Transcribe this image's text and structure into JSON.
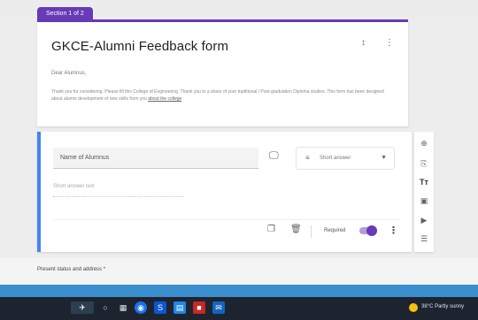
{
  "section_tab": "Section 1 of 2",
  "form": {
    "title": "GKCE-Alumni Feedback form",
    "greeting": "Dear Alumnus,",
    "description": "Thank you for considering. Please fill this College of Engineering. Thank you to a share of your traditional / Post-graduation Diploma studies. This form has been designed about alumni development of new skills from you",
    "description_link": "about the college"
  },
  "question": {
    "title": "Name of Alumnus",
    "type_label": "Short answer",
    "answer_placeholder": "Short answer text",
    "required_label": "Required"
  },
  "next_question": "Present status and address *",
  "taskbar": {
    "weather": "38°C Partly sunny"
  },
  "colors": {
    "accent": "#673ab7",
    "active_border": "#4285f4"
  },
  "icons": {
    "palette": "palette-icon",
    "more": "more-vert-icon",
    "image": "image-icon",
    "type": "short-text-icon",
    "duplicate": "copy-icon",
    "delete": "trash-icon",
    "add_question": "add-circle-icon",
    "import": "import-icon",
    "title_text": "text-title-icon",
    "add_image": "image-icon",
    "add_video": "video-icon",
    "add_section": "section-icon"
  }
}
